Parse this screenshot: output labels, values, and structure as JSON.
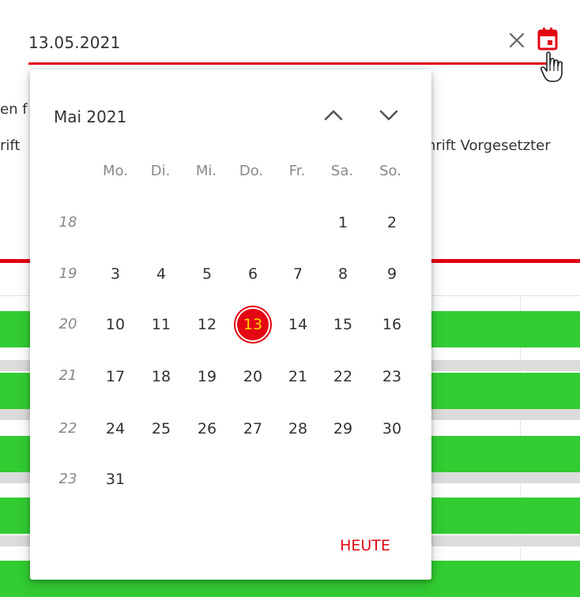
{
  "date_input": {
    "value": "13.05.2021",
    "clear_icon": "close-icon",
    "calendar_icon": "calendar-icon",
    "accent": "#e30613"
  },
  "background": {
    "text_fragment_1": "en f",
    "text_fragment_2": "rift",
    "text_fragment_3": "hrift Vorgesetzter"
  },
  "datepicker": {
    "month_label": "Mai 2021",
    "prev_icon": "chevron-up-icon",
    "next_icon": "chevron-down-icon",
    "weekdays": [
      "Mo.",
      "Di.",
      "Mi.",
      "Do.",
      "Fr.",
      "Sa.",
      "So."
    ],
    "weeks": [
      {
        "number": "18",
        "days": [
          "",
          "",
          "",
          "",
          "",
          "1",
          "2"
        ]
      },
      {
        "number": "19",
        "days": [
          "3",
          "4",
          "5",
          "6",
          "7",
          "8",
          "9"
        ]
      },
      {
        "number": "20",
        "days": [
          "10",
          "11",
          "12",
          "13",
          "14",
          "15",
          "16"
        ]
      },
      {
        "number": "21",
        "days": [
          "17",
          "18",
          "19",
          "20",
          "21",
          "22",
          "23"
        ]
      },
      {
        "number": "22",
        "days": [
          "24",
          "25",
          "26",
          "27",
          "28",
          "29",
          "30"
        ]
      },
      {
        "number": "23",
        "days": [
          "31",
          "",
          "",
          "",
          "",
          "",
          ""
        ]
      }
    ],
    "selected_day": "13",
    "today_button": "HEUTE"
  }
}
